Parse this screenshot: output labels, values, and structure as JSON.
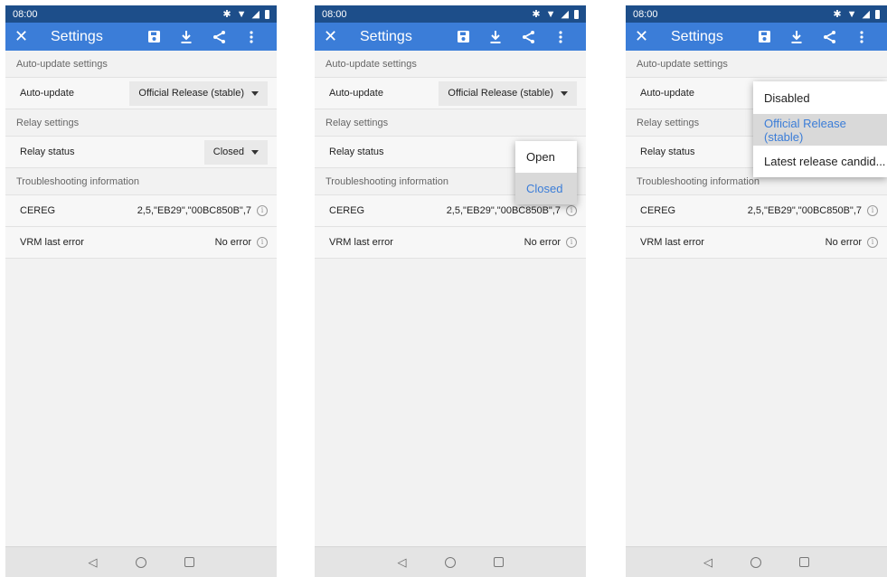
{
  "screens": [
    {
      "status": {
        "time": "08:00"
      },
      "toolbar": {
        "close": "✕",
        "title": "Settings"
      },
      "sections": {
        "auto": "Auto-update settings",
        "relay": "Relay settings",
        "trouble": "Troubleshooting information"
      },
      "auto_update": {
        "label": "Auto-update",
        "value": "Official Release (stable)"
      },
      "relay_status": {
        "label": "Relay status",
        "value": "Closed"
      },
      "cereg": {
        "label": "CEREG",
        "value": "2,5,\"EB29\",\"00BC850B\",7"
      },
      "vrm": {
        "label": "VRM last error",
        "value": "No error"
      }
    },
    {
      "status": {
        "time": "08:00"
      },
      "toolbar": {
        "close": "✕",
        "title": "Settings"
      },
      "sections": {
        "auto": "Auto-update settings",
        "relay": "Relay settings",
        "trouble": "Troubleshooting information"
      },
      "auto_update": {
        "label": "Auto-update",
        "value": "Official Release (stable)"
      },
      "relay_status": {
        "label": "Relay status"
      },
      "relay_menu": {
        "options": [
          "Open",
          "Closed"
        ],
        "selected": "Closed"
      },
      "cereg": {
        "label": "CEREG",
        "value": "2,5,\"EB29\",\"00BC850B\",7"
      },
      "vrm": {
        "label": "VRM last error",
        "value": "No error"
      }
    },
    {
      "status": {
        "time": "08:00"
      },
      "toolbar": {
        "close": "✕",
        "title": "Settings"
      },
      "sections": {
        "auto": "Auto-update settings",
        "relay": "Relay settings",
        "trouble": "Troubleshooting information"
      },
      "auto_update": {
        "label": "Auto-update"
      },
      "auto_menu": {
        "options": [
          "Disabled",
          "Official Release (stable)",
          "Latest release candid..."
        ],
        "selected": "Official Release (stable)"
      },
      "relay_status": {
        "label": "Relay status"
      },
      "cereg": {
        "label": "CEREG",
        "value": "2,5,\"EB29\",\"00BC850B\",7"
      },
      "vrm": {
        "label": "VRM last error",
        "value": "No error"
      }
    }
  ],
  "colors": {
    "status_bar": "#1d4e8a",
    "toolbar": "#3b7dd8",
    "selected_text": "#3b7dd8"
  },
  "icons": [
    "close-icon",
    "save-icon",
    "download-icon",
    "share-icon",
    "more-vert-icon",
    "info-icon",
    "chevron-down-icon",
    "back-icon",
    "home-icon",
    "recents-icon"
  ]
}
